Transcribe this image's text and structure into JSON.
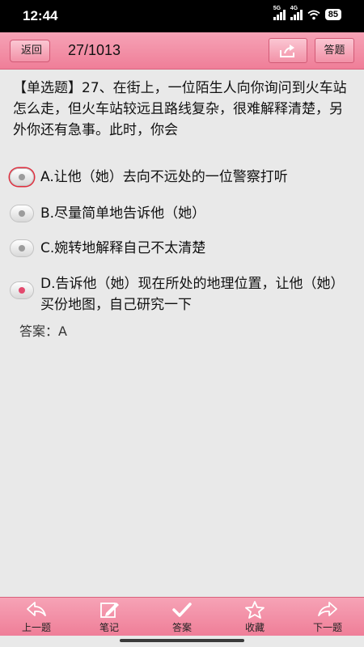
{
  "status": {
    "time": "12:44",
    "net1": "5G",
    "net2": "4G",
    "battery": "85"
  },
  "header": {
    "back_label": "返回",
    "counter": "27/1013",
    "answer_label": "答题"
  },
  "question": {
    "text": "【单选题】27、在街上，一位陌生人向你询问到火车站怎么走，但火车站较远且路线复杂，很难解释清楚，另外你还有急事。此时，你会"
  },
  "options": [
    {
      "text": "A.让他（她）去向不远处的一位警察打听",
      "selected": false
    },
    {
      "text": "B.尽量简单地告诉他（她）",
      "selected": false
    },
    {
      "text": "C.婉转地解释自己不太清楚",
      "selected": false
    },
    {
      "text": "D.告诉他（她）现在所处的地理位置，让他（她）买份地图，自己研究一下",
      "selected": true
    }
  ],
  "answer": {
    "text": "答案：A"
  },
  "nav": {
    "prev": "上一题",
    "notes": "笔记",
    "answer": "答案",
    "favorite": "收藏",
    "next": "下一题"
  },
  "colors": {
    "accent": "#ef7e98",
    "selected_dot": "#e34a6e",
    "mark_ring": "#e02d3d"
  },
  "icons": [
    "back-arrow-icon",
    "share-icon",
    "pencil-icon",
    "checkmark-icon",
    "star-icon",
    "forward-arrow-icon"
  ]
}
